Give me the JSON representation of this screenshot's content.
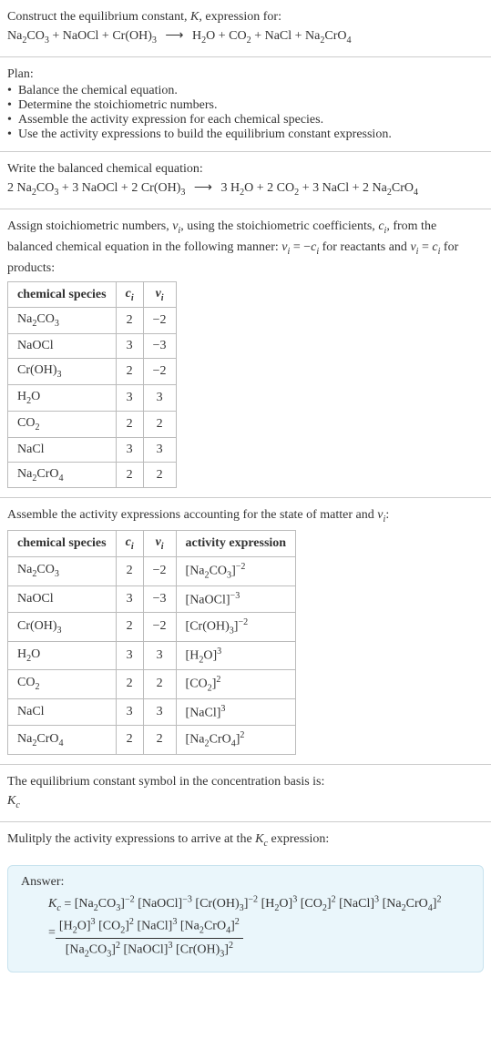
{
  "intro": {
    "line1": "Construct the equilibrium constant, K, expression for:",
    "eq_lhs": "Na₂CO₃ + NaOCl + Cr(OH)₃",
    "eq_rhs": "H₂O + CO₂ + NaCl + Na₂CrO₄",
    "arrow": "⟶"
  },
  "plan": {
    "heading": "Plan:",
    "items": [
      "Balance the chemical equation.",
      "Determine the stoichiometric numbers.",
      "Assemble the activity expression for each chemical species.",
      "Use the activity expressions to build the equilibrium constant expression."
    ]
  },
  "balanced": {
    "heading": "Write the balanced chemical equation:",
    "eq_lhs": "2 Na₂CO₃ + 3 NaOCl + 2 Cr(OH)₃",
    "eq_rhs": "3 H₂O + 2 CO₂ + 3 NaCl + 2 Na₂CrO₄",
    "arrow": "⟶"
  },
  "stoich": {
    "intro_a": "Assign stoichiometric numbers, νᵢ, using the stoichiometric coefficients, cᵢ, from the balanced chemical equation in the following manner: νᵢ = −cᵢ for reactants and νᵢ = cᵢ for products:",
    "headers": {
      "species": "chemical species",
      "ci": "cᵢ",
      "vi": "νᵢ"
    },
    "rows": [
      {
        "sp": "Na₂CO₃",
        "c": "2",
        "v": "−2"
      },
      {
        "sp": "NaOCl",
        "c": "3",
        "v": "−3"
      },
      {
        "sp": "Cr(OH)₃",
        "c": "2",
        "v": "−2"
      },
      {
        "sp": "H₂O",
        "c": "3",
        "v": "3"
      },
      {
        "sp": "CO₂",
        "c": "2",
        "v": "2"
      },
      {
        "sp": "NaCl",
        "c": "3",
        "v": "3"
      },
      {
        "sp": "Na₂CrO₄",
        "c": "2",
        "v": "2"
      }
    ]
  },
  "activity": {
    "heading": "Assemble the activity expressions accounting for the state of matter and νᵢ:",
    "headers": {
      "species": "chemical species",
      "ci": "cᵢ",
      "vi": "νᵢ",
      "ae": "activity expression"
    },
    "rows": [
      {
        "sp": "Na₂CO₃",
        "c": "2",
        "v": "−2",
        "ae_base": "[Na₂CO₃]",
        "ae_exp": "−2"
      },
      {
        "sp": "NaOCl",
        "c": "3",
        "v": "−3",
        "ae_base": "[NaOCl]",
        "ae_exp": "−3"
      },
      {
        "sp": "Cr(OH)₃",
        "c": "2",
        "v": "−2",
        "ae_base": "[Cr(OH)₃]",
        "ae_exp": "−2"
      },
      {
        "sp": "H₂O",
        "c": "3",
        "v": "3",
        "ae_base": "[H₂O]",
        "ae_exp": "3"
      },
      {
        "sp": "CO₂",
        "c": "2",
        "v": "2",
        "ae_base": "[CO₂]",
        "ae_exp": "2"
      },
      {
        "sp": "NaCl",
        "c": "3",
        "v": "3",
        "ae_base": "[NaCl]",
        "ae_exp": "3"
      },
      {
        "sp": "Na₂CrO₄",
        "c": "2",
        "v": "2",
        "ae_base": "[Na₂CrO₄]",
        "ae_exp": "2"
      }
    ]
  },
  "basis": {
    "line": "The equilibrium constant symbol in the concentration basis is:",
    "symbol": "K꜀"
  },
  "multiply": {
    "line": "Mulitply the activity expressions to arrive at the K꜀ expression:"
  },
  "answer": {
    "label": "Answer:",
    "kc": "K꜀ = ",
    "flat": "[Na₂CO₃]⁻² [NaOCl]⁻³ [Cr(OH)₃]⁻² [H₂O]³ [CO₂]² [NaCl]³ [Na₂CrO₄]²",
    "eq2": " = ",
    "num": "[H₂O]³ [CO₂]² [NaCl]³ [Na₂CrO₄]²",
    "den": "[Na₂CO₃]² [NaOCl]³ [Cr(OH)₃]²"
  }
}
